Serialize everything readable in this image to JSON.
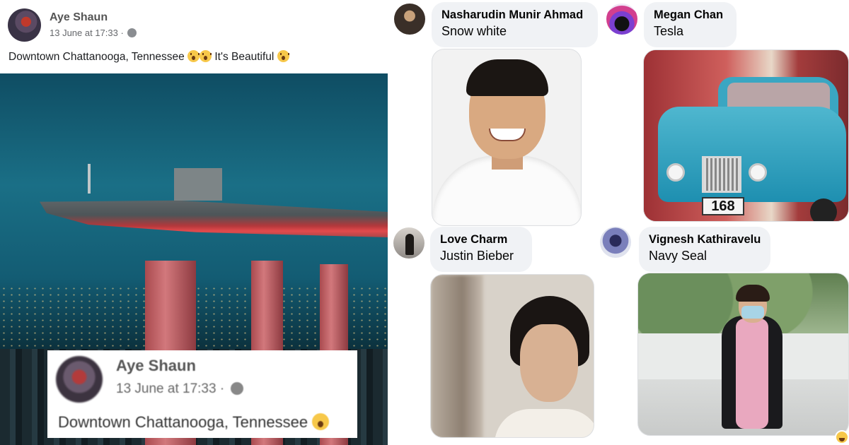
{
  "post": {
    "author": "Aye Shaun",
    "timestamp": "13 June at 17:33 ·",
    "privacy_icon": "globe-icon",
    "text": "Downtown Chattanooga, Tennessee",
    "text_suffix": "It's Beautiful",
    "emoji_icon": "astonished-emoji-icon"
  },
  "inset": {
    "author": "Aye Shaun",
    "timestamp": "13 June at 17:33 ·",
    "text": "Downtown Chattanooga, Tennessee"
  },
  "comments": [
    {
      "author": "Nasharudin Munir Ahmad",
      "text": "Snow white"
    },
    {
      "author": "Megan Chan",
      "text": "Tesla"
    },
    {
      "author": "Love Charm",
      "text": "Justin Bieber"
    },
    {
      "author": "Vignesh Kathiravelu",
      "text": "Navy Seal"
    }
  ],
  "car_plate": "168",
  "reaction_icon": "haha-reaction-icon",
  "colors": {
    "bubble": "#f0f2f5",
    "meta": "#65676b",
    "sky": "#1a6f86"
  }
}
